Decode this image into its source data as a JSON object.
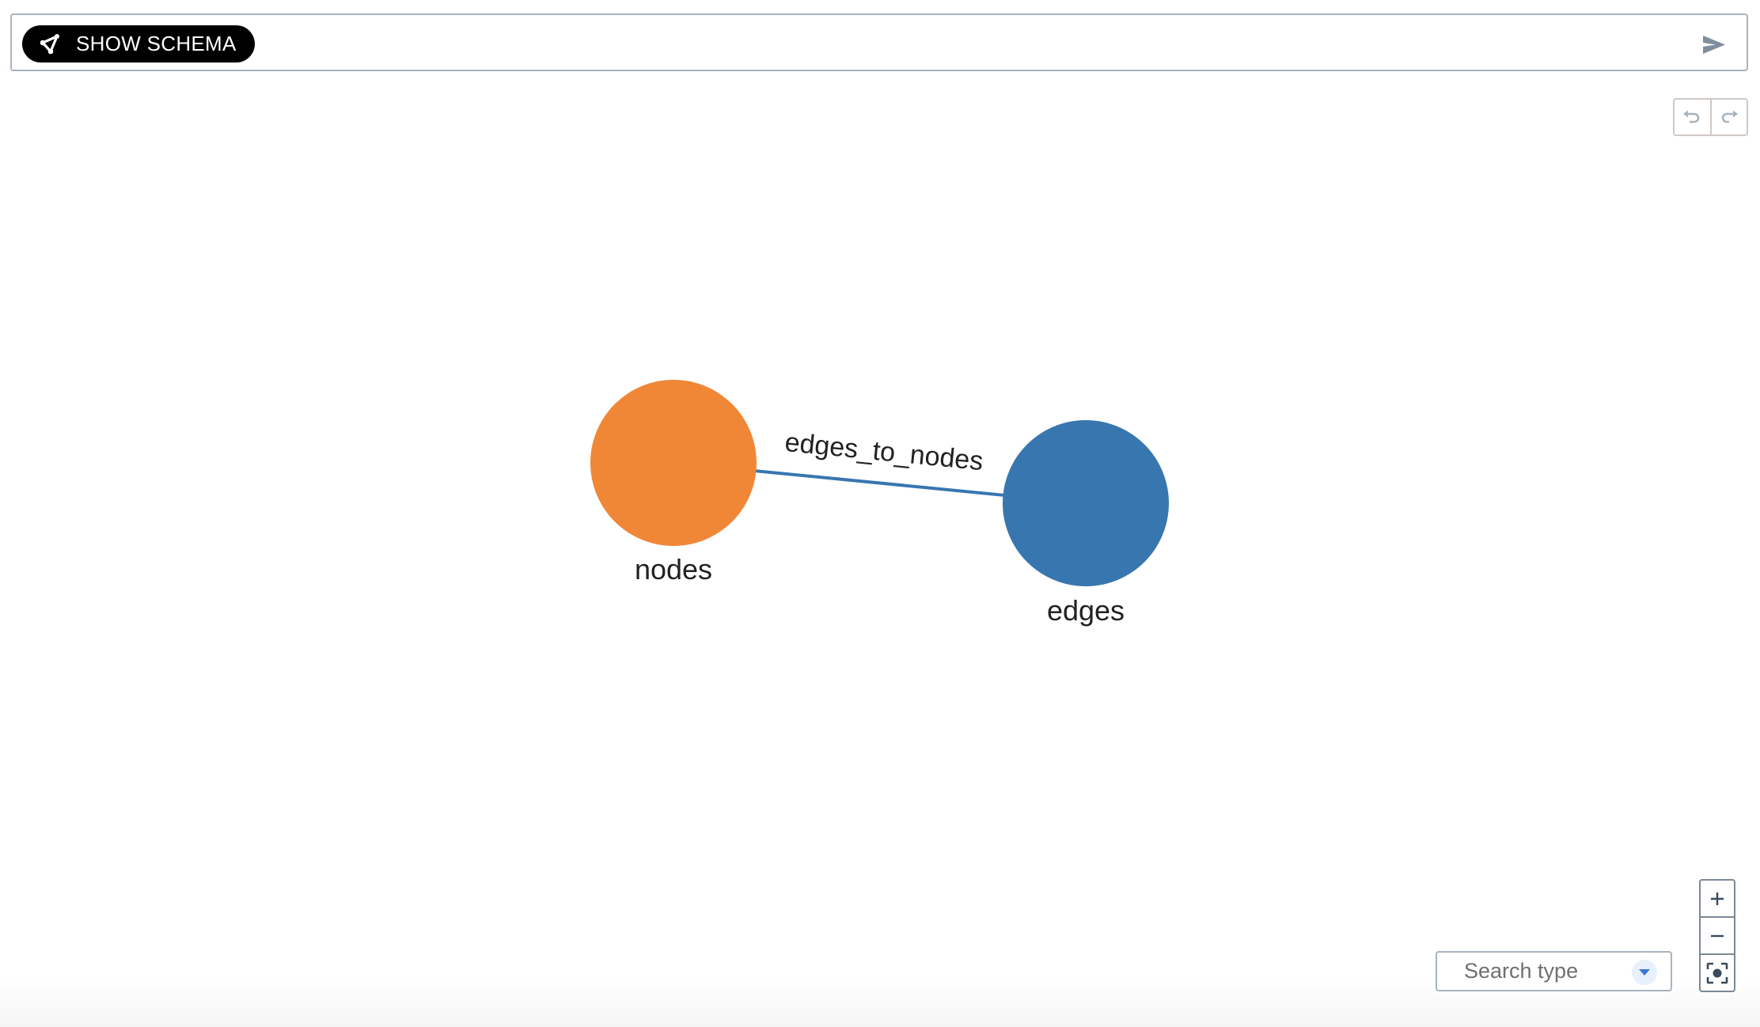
{
  "toolbar": {
    "show_schema_label": "SHOW SCHEMA",
    "show_schema_icon": "schema-graph-icon",
    "send_icon": "send-icon"
  },
  "history": {
    "undo_icon": "undo-icon",
    "redo_icon": "redo-icon"
  },
  "graph": {
    "nodes": [
      {
        "id": "nodes",
        "label": "nodes",
        "color": "#f08737"
      },
      {
        "id": "edges",
        "label": "edges",
        "color": "#3876b0"
      }
    ],
    "edges": [
      {
        "source": "nodes",
        "target": "edges",
        "label": "edges_to_nodes",
        "color": "#3876b0"
      }
    ]
  },
  "search_type": {
    "placeholder": "Search type",
    "dropdown_icon": "caret-down-icon",
    "accent": "#3a78d4"
  },
  "zoom_controls": {
    "zoom_in": "+",
    "zoom_out": "−",
    "fit_icon": "fit-to-screen-icon"
  }
}
